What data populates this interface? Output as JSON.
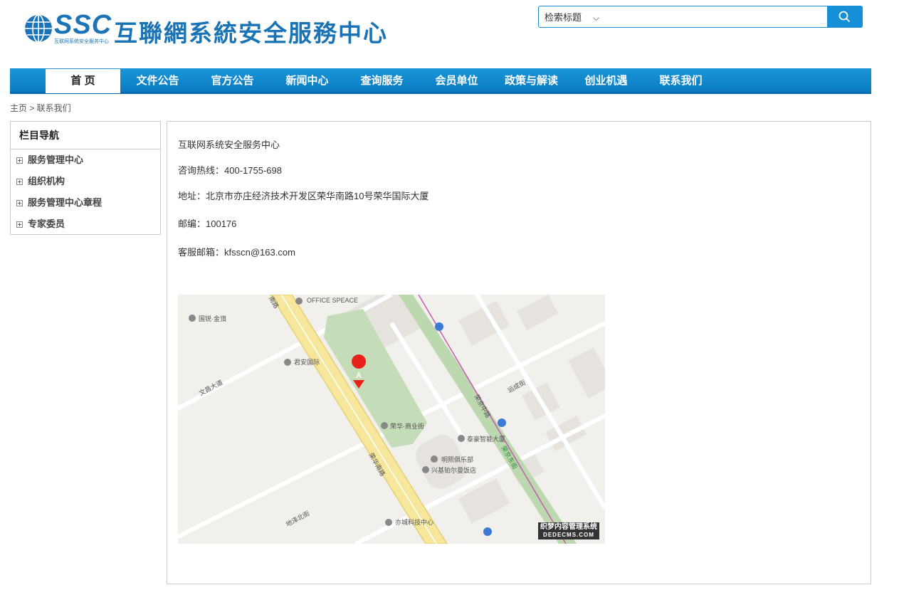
{
  "header": {
    "logo_ssc": "SSC",
    "logo_sub": "互联网系统安全服务中心",
    "logo_name": "互聯網系統安全服務中心",
    "search": {
      "select_value": "检索标题",
      "placeholder": "",
      "button_icon": "search-icon"
    }
  },
  "nav": {
    "items": [
      {
        "label": "首 页",
        "active": true
      },
      {
        "label": "文件公告"
      },
      {
        "label": "官方公告"
      },
      {
        "label": "新闻中心"
      },
      {
        "label": "查询服务"
      },
      {
        "label": "会员单位"
      },
      {
        "label": "政策与解读"
      },
      {
        "label": "创业机遇"
      },
      {
        "label": "联系我们"
      }
    ]
  },
  "breadcrumb": "主页 > 联系我们",
  "sidebar": {
    "title": "栏目导航",
    "items": [
      {
        "label": "服务管理中心"
      },
      {
        "label": "组织机构"
      },
      {
        "label": "服务管理中心章程"
      },
      {
        "label": "专家委员"
      }
    ]
  },
  "content": {
    "org": "互联网系统安全服务中心",
    "hotline": "咨询热线：400-1755-698",
    "address": "地址：北京市亦庄经济技术开发区荣华南路10号荣华国际大厦",
    "postcode": "邮编：100176",
    "email": "客服邮箱：kfsscn@163.com"
  },
  "map": {
    "labels": {
      "office": "OFFICE SPEACE",
      "guoyin": "国锐·金嵿",
      "junan": "君安国际",
      "wenchang": "文昌大道",
      "yunchengjie": "运成街",
      "rongjingzhonglu": "荣京中路",
      "ronghua_street": "荣华·商业街",
      "taihao": "泰豪智能大厦",
      "mingxi": "明熙俱乐部",
      "xingji": "兴基铂尔曼饭店",
      "ronghuananlu": "荣华南路",
      "dizebeijie": "地泽北街",
      "yicheng": "亦城科技中心",
      "rongjing_east": "荣京东街",
      "nanlu_top": "南路",
      "marker": "A"
    },
    "watermark_line1": "织梦内容管理系统",
    "watermark_line2": "DEDECMS.COM"
  }
}
